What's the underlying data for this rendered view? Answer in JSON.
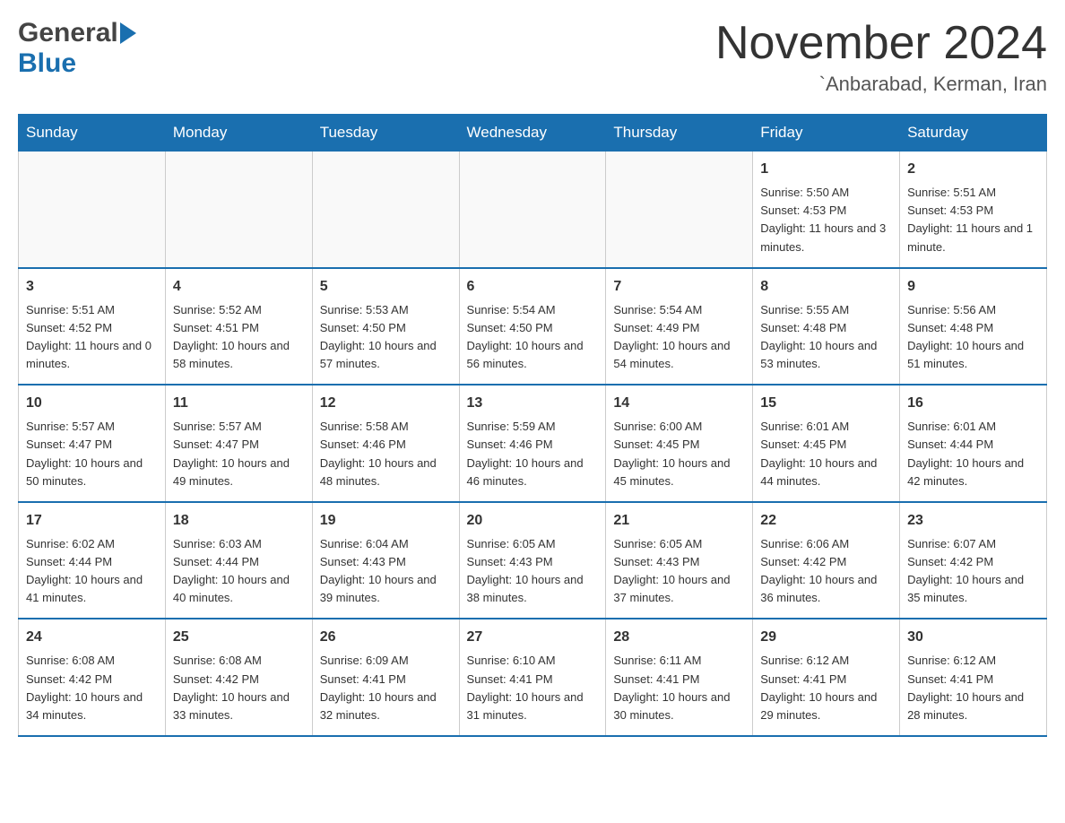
{
  "header": {
    "logo_general": "General",
    "logo_blue": "Blue",
    "title": "November 2024",
    "subtitle": "`Anbarabad, Kerman, Iran"
  },
  "calendar": {
    "days": [
      "Sunday",
      "Monday",
      "Tuesday",
      "Wednesday",
      "Thursday",
      "Friday",
      "Saturday"
    ],
    "weeks": [
      [
        {
          "day": "",
          "info": ""
        },
        {
          "day": "",
          "info": ""
        },
        {
          "day": "",
          "info": ""
        },
        {
          "day": "",
          "info": ""
        },
        {
          "day": "",
          "info": ""
        },
        {
          "day": "1",
          "info": "Sunrise: 5:50 AM\nSunset: 4:53 PM\nDaylight: 11 hours and 3 minutes."
        },
        {
          "day": "2",
          "info": "Sunrise: 5:51 AM\nSunset: 4:53 PM\nDaylight: 11 hours and 1 minute."
        }
      ],
      [
        {
          "day": "3",
          "info": "Sunrise: 5:51 AM\nSunset: 4:52 PM\nDaylight: 11 hours and 0 minutes."
        },
        {
          "day": "4",
          "info": "Sunrise: 5:52 AM\nSunset: 4:51 PM\nDaylight: 10 hours and 58 minutes."
        },
        {
          "day": "5",
          "info": "Sunrise: 5:53 AM\nSunset: 4:50 PM\nDaylight: 10 hours and 57 minutes."
        },
        {
          "day": "6",
          "info": "Sunrise: 5:54 AM\nSunset: 4:50 PM\nDaylight: 10 hours and 56 minutes."
        },
        {
          "day": "7",
          "info": "Sunrise: 5:54 AM\nSunset: 4:49 PM\nDaylight: 10 hours and 54 minutes."
        },
        {
          "day": "8",
          "info": "Sunrise: 5:55 AM\nSunset: 4:48 PM\nDaylight: 10 hours and 53 minutes."
        },
        {
          "day": "9",
          "info": "Sunrise: 5:56 AM\nSunset: 4:48 PM\nDaylight: 10 hours and 51 minutes."
        }
      ],
      [
        {
          "day": "10",
          "info": "Sunrise: 5:57 AM\nSunset: 4:47 PM\nDaylight: 10 hours and 50 minutes."
        },
        {
          "day": "11",
          "info": "Sunrise: 5:57 AM\nSunset: 4:47 PM\nDaylight: 10 hours and 49 minutes."
        },
        {
          "day": "12",
          "info": "Sunrise: 5:58 AM\nSunset: 4:46 PM\nDaylight: 10 hours and 48 minutes."
        },
        {
          "day": "13",
          "info": "Sunrise: 5:59 AM\nSunset: 4:46 PM\nDaylight: 10 hours and 46 minutes."
        },
        {
          "day": "14",
          "info": "Sunrise: 6:00 AM\nSunset: 4:45 PM\nDaylight: 10 hours and 45 minutes."
        },
        {
          "day": "15",
          "info": "Sunrise: 6:01 AM\nSunset: 4:45 PM\nDaylight: 10 hours and 44 minutes."
        },
        {
          "day": "16",
          "info": "Sunrise: 6:01 AM\nSunset: 4:44 PM\nDaylight: 10 hours and 42 minutes."
        }
      ],
      [
        {
          "day": "17",
          "info": "Sunrise: 6:02 AM\nSunset: 4:44 PM\nDaylight: 10 hours and 41 minutes."
        },
        {
          "day": "18",
          "info": "Sunrise: 6:03 AM\nSunset: 4:44 PM\nDaylight: 10 hours and 40 minutes."
        },
        {
          "day": "19",
          "info": "Sunrise: 6:04 AM\nSunset: 4:43 PM\nDaylight: 10 hours and 39 minutes."
        },
        {
          "day": "20",
          "info": "Sunrise: 6:05 AM\nSunset: 4:43 PM\nDaylight: 10 hours and 38 minutes."
        },
        {
          "day": "21",
          "info": "Sunrise: 6:05 AM\nSunset: 4:43 PM\nDaylight: 10 hours and 37 minutes."
        },
        {
          "day": "22",
          "info": "Sunrise: 6:06 AM\nSunset: 4:42 PM\nDaylight: 10 hours and 36 minutes."
        },
        {
          "day": "23",
          "info": "Sunrise: 6:07 AM\nSunset: 4:42 PM\nDaylight: 10 hours and 35 minutes."
        }
      ],
      [
        {
          "day": "24",
          "info": "Sunrise: 6:08 AM\nSunset: 4:42 PM\nDaylight: 10 hours and 34 minutes."
        },
        {
          "day": "25",
          "info": "Sunrise: 6:08 AM\nSunset: 4:42 PM\nDaylight: 10 hours and 33 minutes."
        },
        {
          "day": "26",
          "info": "Sunrise: 6:09 AM\nSunset: 4:41 PM\nDaylight: 10 hours and 32 minutes."
        },
        {
          "day": "27",
          "info": "Sunrise: 6:10 AM\nSunset: 4:41 PM\nDaylight: 10 hours and 31 minutes."
        },
        {
          "day": "28",
          "info": "Sunrise: 6:11 AM\nSunset: 4:41 PM\nDaylight: 10 hours and 30 minutes."
        },
        {
          "day": "29",
          "info": "Sunrise: 6:12 AM\nSunset: 4:41 PM\nDaylight: 10 hours and 29 minutes."
        },
        {
          "day": "30",
          "info": "Sunrise: 6:12 AM\nSunset: 4:41 PM\nDaylight: 10 hours and 28 minutes."
        }
      ]
    ]
  }
}
